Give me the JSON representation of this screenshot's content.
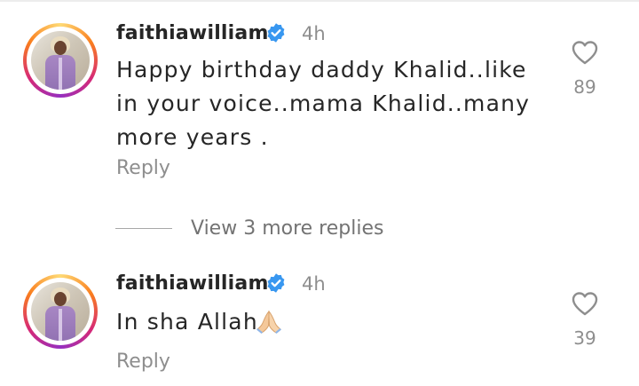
{
  "comments": [
    {
      "username": "faithiawilliams",
      "time": "4h",
      "text": "Happy birthday daddy Khalid..like in your voice..mama Khalid..many more years .",
      "reply_label": "Reply",
      "likes": "89",
      "icons": {
        "verified": "verified-badge-icon",
        "like": "heart-icon"
      }
    },
    {
      "username": "faithiawilliams",
      "time": "4h",
      "text": "In sha Allah",
      "emoji": "folded-hands",
      "reply_label": "Reply",
      "likes": "39",
      "icons": {
        "verified": "verified-badge-icon",
        "like": "heart-icon"
      }
    }
  ],
  "view_replies": "View 3 more replies",
  "colors": {
    "verified": "#3897f0",
    "secondary_text": "#8e8e8e",
    "primary_text": "#262626"
  }
}
